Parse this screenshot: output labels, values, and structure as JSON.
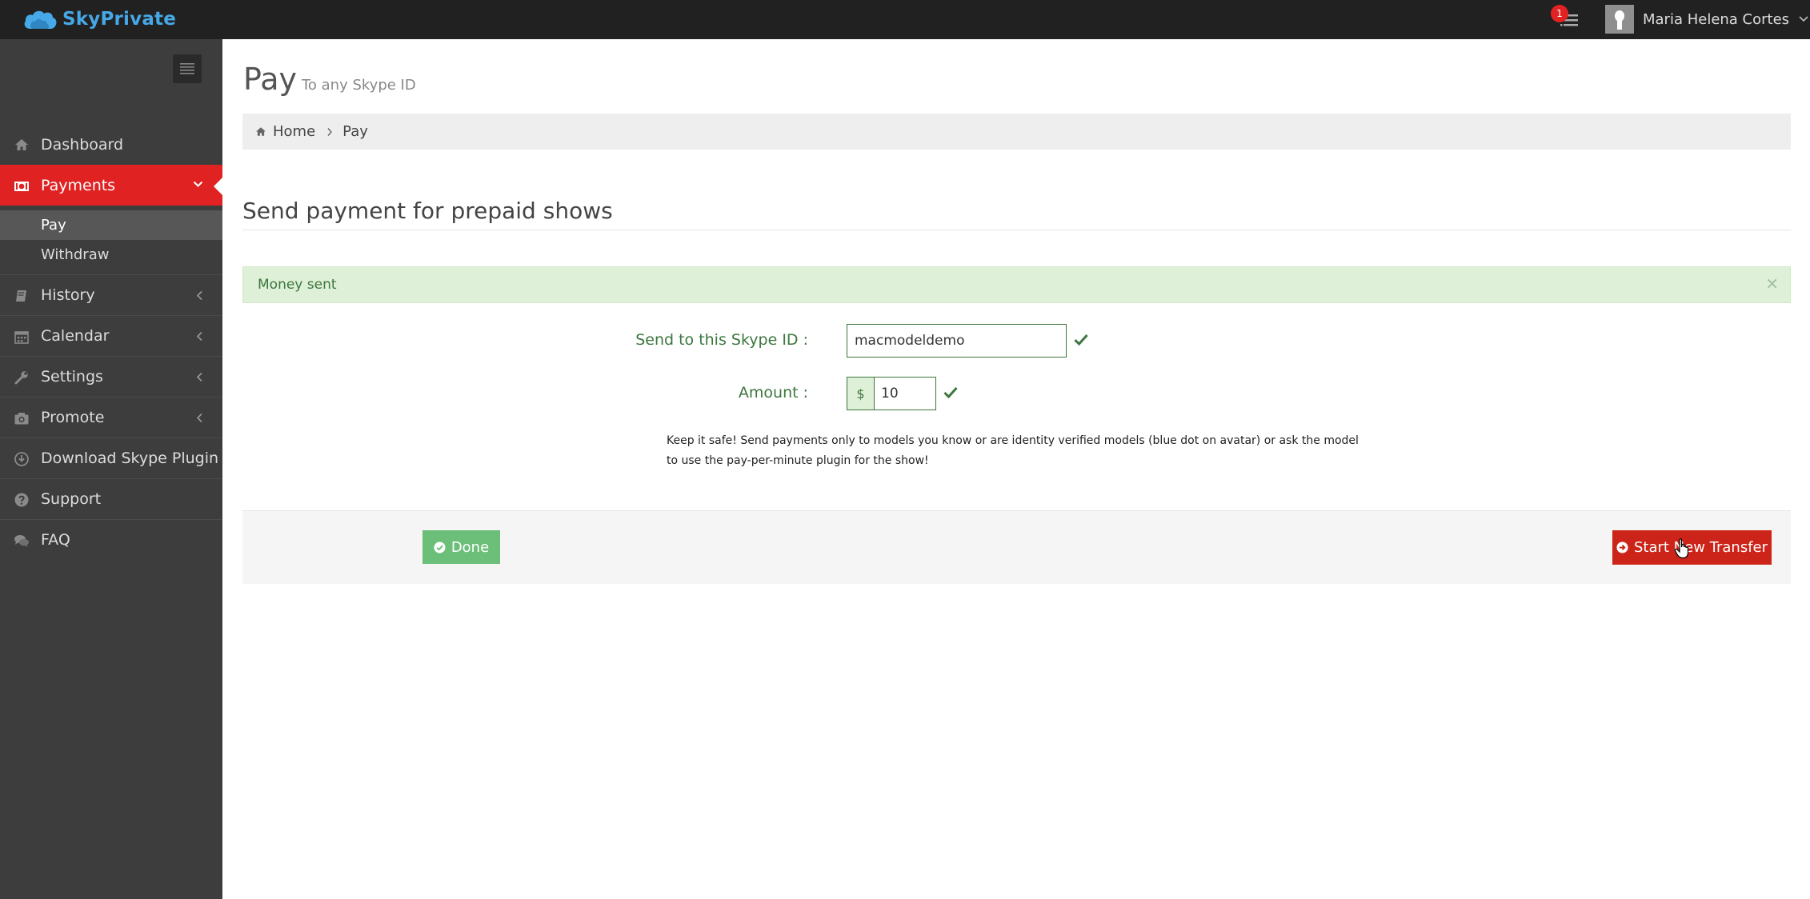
{
  "app": {
    "name": "SkyPrivate",
    "brand_color": "#46a8e6",
    "accent_color": "#e02222"
  },
  "header": {
    "notification_count": "1",
    "user_name": "Maria Helena Cortes",
    "icons": [
      "cloud-logo-icon",
      "tasks-icon",
      "user-avatar-icon",
      "chevron-down-icon"
    ]
  },
  "sidebar": {
    "items": [
      {
        "label": "Dashboard",
        "icon": "home-icon"
      },
      {
        "label": "Payments",
        "icon": "money-icon",
        "active": true
      },
      {
        "label": "History",
        "icon": "book-icon"
      },
      {
        "label": "Calendar",
        "icon": "calendar-icon"
      },
      {
        "label": "Settings",
        "icon": "wrench-icon"
      },
      {
        "label": "Promote",
        "icon": "camera-icon"
      },
      {
        "label": "Download Skype Plugin",
        "icon": "download-icon"
      },
      {
        "label": "Support",
        "icon": "question-icon"
      },
      {
        "label": "FAQ",
        "icon": "comments-icon"
      }
    ],
    "payments_sub": [
      {
        "label": "Pay",
        "active": true
      },
      {
        "label": "Withdraw"
      }
    ]
  },
  "page": {
    "title": "Pay",
    "subtitle": "To any Skype ID"
  },
  "breadcrumb": {
    "home": "Home",
    "current": "Pay"
  },
  "section": {
    "title": "Send payment for prepaid shows"
  },
  "alert": {
    "message": "Money sent",
    "close": "×"
  },
  "form": {
    "skype_label": "Send to this Skype ID :",
    "skype_value": "macmodeldemo",
    "amount_label": "Amount :",
    "currency": "$",
    "amount_value": "10",
    "help": "Keep it safe! Send payments only to models you know or are identity verified models (blue dot on avatar) or ask the model to use the pay-per-minute plugin for the show!"
  },
  "actions": {
    "done_label": "Done",
    "start_label": "Start New Transfer"
  }
}
